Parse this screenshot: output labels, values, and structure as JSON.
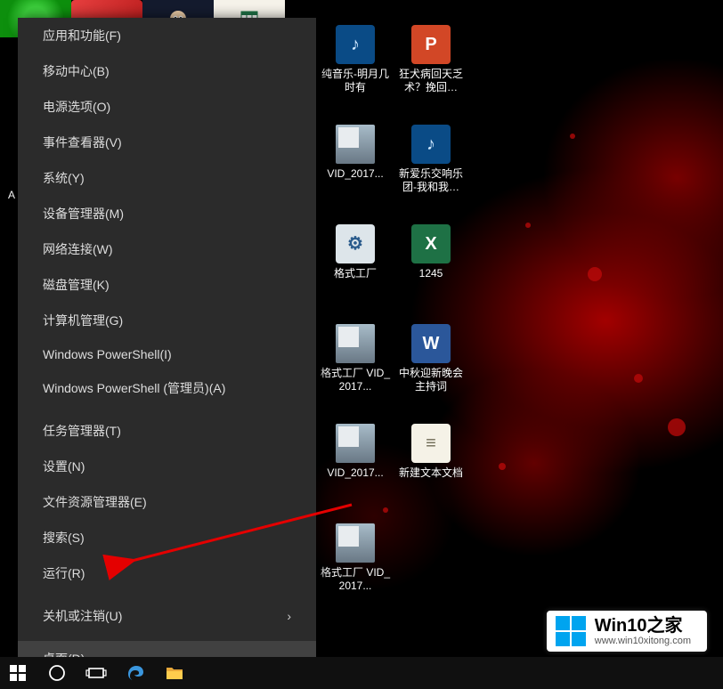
{
  "menu": {
    "groups": [
      [
        "应用和功能(F)",
        "移动中心(B)",
        "电源选项(O)",
        "事件查看器(V)",
        "系统(Y)",
        "设备管理器(M)",
        "网络连接(W)",
        "磁盘管理(K)",
        "计算机管理(G)",
        "Windows PowerShell(I)",
        "Windows PowerShell (管理员)(A)"
      ],
      [
        "任务管理器(T)",
        "设置(N)",
        "文件资源管理器(E)",
        "搜索(S)",
        "运行(R)"
      ],
      [
        "关机或注销(U)"
      ],
      [
        "桌面(D)"
      ]
    ],
    "submenu_item": "关机或注销(U)",
    "highlighted_item": "桌面(D)"
  },
  "desktop_icons": {
    "col1": [
      {
        "type": "blue-media",
        "glyph": "♪",
        "label": "纯音乐-明月几时有"
      },
      {
        "type": "video",
        "glyph": "",
        "label": "VID_2017..."
      },
      {
        "type": "factory",
        "glyph": "⚙",
        "label": "格式工厂"
      },
      {
        "type": "video",
        "glyph": "",
        "label": "格式工厂 VID_2017..."
      },
      {
        "type": "video",
        "glyph": "",
        "label": "VID_2017..."
      },
      {
        "type": "video",
        "glyph": "",
        "label": "格式工厂 VID_2017..."
      }
    ],
    "col2": [
      {
        "type": "ppt",
        "glyph": "P",
        "label": "狂犬病回天乏术？挽回…"
      },
      {
        "type": "blue-media",
        "glyph": "♪",
        "label": "新爱乐交响乐团-我和我…"
      },
      {
        "type": "excel",
        "glyph": "X",
        "label": "1245"
      },
      {
        "type": "word",
        "glyph": "W",
        "label": "中秋迎新晚会主持词"
      },
      {
        "type": "text",
        "glyph": "≡",
        "label": "新建文本文档"
      }
    ]
  },
  "watermark": {
    "title": "Win10之家",
    "url": "www.win10xitong.com"
  },
  "taskbar_apps": [
    "start",
    "cortana",
    "taskview",
    "edge",
    "explorer"
  ],
  "left_text": "A"
}
